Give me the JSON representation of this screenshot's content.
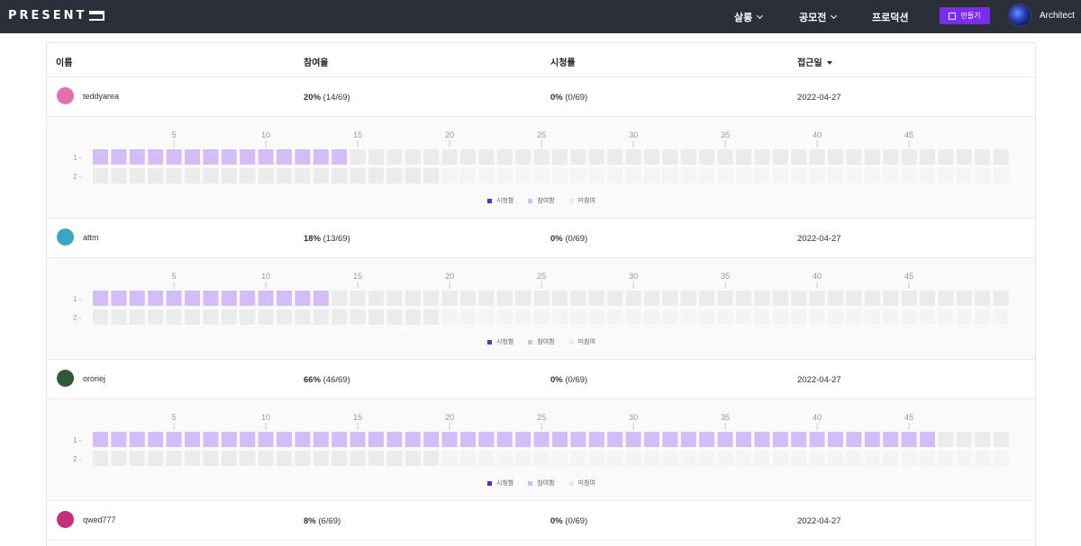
{
  "app": {
    "logo": "PRESENT",
    "username": "Architect",
    "make_label": "만들기"
  },
  "nav": [
    {
      "label": "살롱"
    },
    {
      "label": "공모전"
    },
    {
      "label": "프로덕션"
    }
  ],
  "table": {
    "columns": [
      "이름",
      "참여율",
      "시청률",
      "접근일"
    ],
    "legend": {
      "watched": "시청함",
      "participated": "참여함",
      "not_participated": "미참여"
    },
    "axis_ticks": [
      "5",
      "10",
      "15",
      "20",
      "25",
      "30",
      "35",
      "40",
      "45"
    ],
    "row_labels": [
      "1 -",
      "2 -"
    ],
    "colors": {
      "watched": "#5b2bd1",
      "participated": "#d3bdf7",
      "not_participated": "#ebebeb",
      "empty": "#f4f4f4"
    },
    "rows": [
      {
        "name": "teddyarea",
        "participation_pct": "20%",
        "participation_count": "(14/69)",
        "view_pct": "0%",
        "view_count": "(0/69)",
        "date": "2022-04-27",
        "avatar_color": "#e56fa8",
        "series": [
          {
            "participated": 14,
            "total": 50
          },
          {
            "participated": 0,
            "total": 19
          }
        ]
      },
      {
        "name": "attm",
        "participation_pct": "18%",
        "participation_count": "(13/69)",
        "view_pct": "0%",
        "view_count": "(0/69)",
        "date": "2022-04-27",
        "avatar_color": "#3aa6c4",
        "series": [
          {
            "participated": 13,
            "total": 50
          },
          {
            "participated": 0,
            "total": 19
          }
        ]
      },
      {
        "name": "ororiej",
        "participation_pct": "66%",
        "participation_count": "(46/69)",
        "view_pct": "0%",
        "view_count": "(0/69)",
        "date": "2022-04-27",
        "avatar_color": "#2f5a3a",
        "series": [
          {
            "participated": 46,
            "total": 50
          },
          {
            "participated": 0,
            "total": 19
          }
        ]
      },
      {
        "name": "qwed777",
        "participation_pct": "8%",
        "participation_count": "(6/69)",
        "view_pct": "0%",
        "view_count": "(0/69)",
        "date": "2022-04-27",
        "avatar_color": "#c4307a",
        "series": null
      }
    ]
  }
}
